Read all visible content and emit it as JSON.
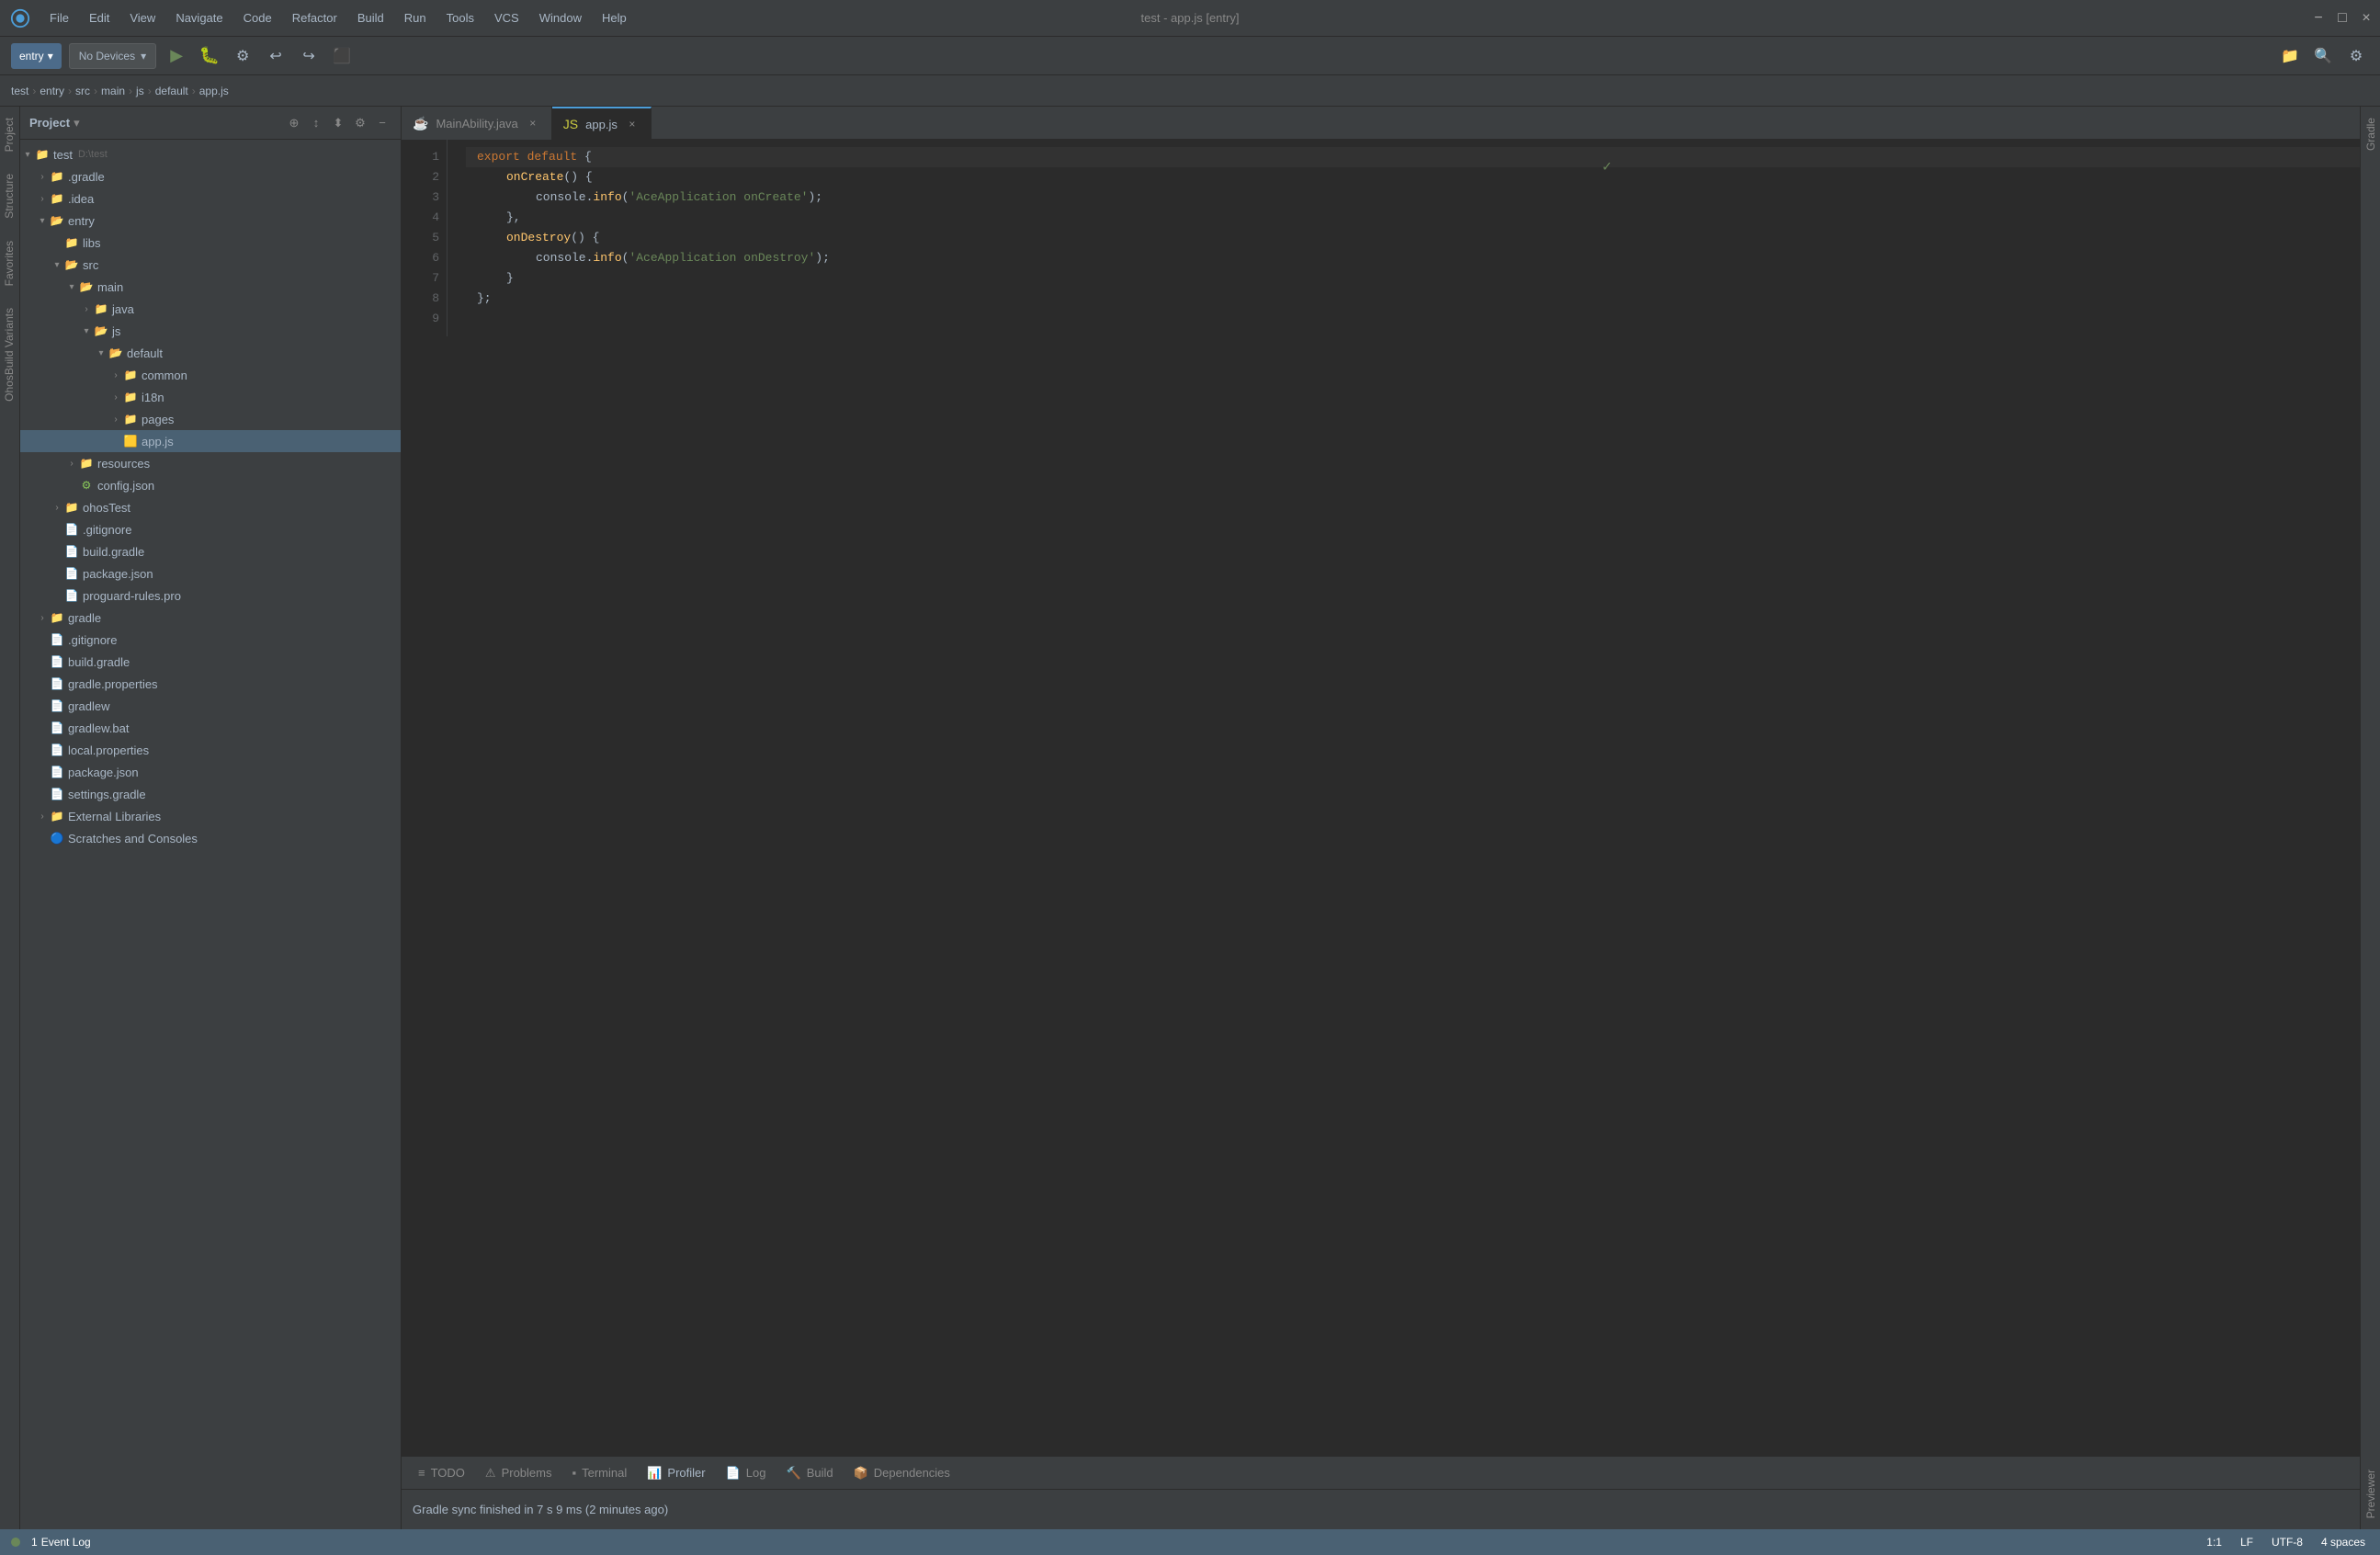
{
  "app": {
    "title": "test - app.js [entry]"
  },
  "menubar": {
    "logo_symbol": "◎",
    "items": [
      "File",
      "Edit",
      "View",
      "Navigate",
      "Code",
      "Refactor",
      "Build",
      "Run",
      "Tools",
      "VCS",
      "Window",
      "Help"
    ],
    "window_controls": [
      "−",
      "□",
      "×"
    ]
  },
  "breadcrumb": {
    "items": [
      "test",
      "entry",
      "src",
      "main",
      "js",
      "default",
      "app.js"
    ]
  },
  "toolbar": {
    "entry_label": "entry",
    "device_label": "No Devices",
    "run_symbol": "▶",
    "icons": [
      "⚙",
      "↩",
      "↪",
      "⬛",
      "📁",
      "🔍",
      "⚙"
    ]
  },
  "sidebar": {
    "title": "Project",
    "dropdown_symbol": "▾",
    "action_icons": [
      "⊕",
      "↕",
      "⬍",
      "⚙",
      "−"
    ],
    "tree": [
      {
        "id": "test",
        "label": "test",
        "suffix": "D:\\test",
        "level": 0,
        "type": "project",
        "open": true,
        "has_arrow": true
      },
      {
        "id": "gradle-dir",
        "label": ".gradle",
        "level": 1,
        "type": "folder",
        "open": false,
        "has_arrow": true
      },
      {
        "id": "idea-dir",
        "label": ".idea",
        "level": 1,
        "type": "folder",
        "open": false,
        "has_arrow": true
      },
      {
        "id": "entry-dir",
        "label": "entry",
        "level": 1,
        "type": "folder",
        "open": true,
        "has_arrow": true
      },
      {
        "id": "libs",
        "label": "libs",
        "level": 2,
        "type": "folder",
        "open": false,
        "has_arrow": false
      },
      {
        "id": "src-dir",
        "label": "src",
        "level": 2,
        "type": "folder",
        "open": true,
        "has_arrow": true
      },
      {
        "id": "main-dir",
        "label": "main",
        "level": 3,
        "type": "folder",
        "open": true,
        "has_arrow": true
      },
      {
        "id": "java-dir",
        "label": "java",
        "level": 4,
        "type": "folder",
        "open": false,
        "has_arrow": true
      },
      {
        "id": "js-dir",
        "label": "js",
        "level": 4,
        "type": "folder",
        "open": true,
        "has_arrow": true
      },
      {
        "id": "default-dir",
        "label": "default",
        "level": 5,
        "type": "folder",
        "open": true,
        "has_arrow": true
      },
      {
        "id": "common-dir",
        "label": "common",
        "level": 6,
        "type": "folder",
        "open": false,
        "has_arrow": true
      },
      {
        "id": "i18n-dir",
        "label": "i18n",
        "level": 6,
        "type": "folder",
        "open": false,
        "has_arrow": true
      },
      {
        "id": "pages-dir",
        "label": "pages",
        "level": 6,
        "type": "folder",
        "open": false,
        "has_arrow": true
      },
      {
        "id": "app-js",
        "label": "app.js",
        "level": 6,
        "type": "file-js",
        "open": false,
        "has_arrow": false,
        "selected": true
      },
      {
        "id": "resources-dir",
        "label": "resources",
        "level": 3,
        "type": "folder",
        "open": false,
        "has_arrow": true
      },
      {
        "id": "config-json",
        "label": "config.json",
        "level": 3,
        "type": "file-config",
        "open": false,
        "has_arrow": false
      },
      {
        "id": "ohostest-dir",
        "label": "ohosTest",
        "level": 2,
        "type": "folder",
        "open": false,
        "has_arrow": true
      },
      {
        "id": "gitignore",
        "label": ".gitignore",
        "level": 2,
        "type": "file-generic",
        "open": false,
        "has_arrow": false
      },
      {
        "id": "build-gradle",
        "label": "build.gradle",
        "level": 2,
        "type": "file-gradle",
        "open": false,
        "has_arrow": false
      },
      {
        "id": "package-json",
        "label": "package.json",
        "level": 2,
        "type": "file-json",
        "open": false,
        "has_arrow": false
      },
      {
        "id": "proguard",
        "label": "proguard-rules.pro",
        "level": 2,
        "type": "file-generic",
        "open": false,
        "has_arrow": false
      },
      {
        "id": "gradle-dir2",
        "label": "gradle",
        "level": 1,
        "type": "folder",
        "open": false,
        "has_arrow": true
      },
      {
        "id": "gitignore2",
        "label": ".gitignore",
        "level": 1,
        "type": "file-generic",
        "open": false,
        "has_arrow": false
      },
      {
        "id": "build-gradle2",
        "label": "build.gradle",
        "level": 1,
        "type": "file-gradle",
        "open": false,
        "has_arrow": false
      },
      {
        "id": "gradle-props",
        "label": "gradle.properties",
        "level": 1,
        "type": "file-gradle",
        "open": false,
        "has_arrow": false
      },
      {
        "id": "gradlew",
        "label": "gradlew",
        "level": 1,
        "type": "file-generic",
        "open": false,
        "has_arrow": false
      },
      {
        "id": "gradlew-bat",
        "label": "gradlew.bat",
        "level": 1,
        "type": "file-generic",
        "open": false,
        "has_arrow": false
      },
      {
        "id": "local-props",
        "label": "local.properties",
        "level": 1,
        "type": "file-generic",
        "open": false,
        "has_arrow": false
      },
      {
        "id": "package-json2",
        "label": "package.json",
        "level": 1,
        "type": "file-json",
        "open": false,
        "has_arrow": false
      },
      {
        "id": "settings-gradle",
        "label": "settings.gradle",
        "level": 1,
        "type": "file-gradle",
        "open": false,
        "has_arrow": false
      },
      {
        "id": "external-libs",
        "label": "External Libraries",
        "level": 1,
        "type": "folder",
        "open": false,
        "has_arrow": true
      },
      {
        "id": "scratches",
        "label": "Scratches and Consoles",
        "level": 1,
        "type": "folder-special",
        "open": false,
        "has_arrow": false
      }
    ]
  },
  "editor": {
    "tabs": [
      {
        "id": "tab-main",
        "label": "MainAbility.java",
        "type": "java",
        "active": false,
        "closeable": true
      },
      {
        "id": "tab-app",
        "label": "app.js",
        "type": "js",
        "active": true,
        "closeable": true
      }
    ],
    "code_lines": [
      {
        "num": 1,
        "content": "export default {",
        "highlighted": true
      },
      {
        "num": 2,
        "content": "    onCreate() {"
      },
      {
        "num": 3,
        "content": "        console.info('AceApplication onCreate');"
      },
      {
        "num": 4,
        "content": "    },"
      },
      {
        "num": 5,
        "content": "    onDestroy() {"
      },
      {
        "num": 6,
        "content": "        console.info('AceApplication onDestroy');"
      },
      {
        "num": 7,
        "content": "    }"
      },
      {
        "num": 8,
        "content": "};"
      },
      {
        "num": 9,
        "content": ""
      }
    ]
  },
  "bottom_panel": {
    "tabs": [
      {
        "id": "todo",
        "label": "TODO",
        "icon": "≡"
      },
      {
        "id": "problems",
        "label": "Problems",
        "icon": "⚠"
      },
      {
        "id": "terminal",
        "label": "Terminal",
        "icon": "▪"
      },
      {
        "id": "profiler",
        "label": "Profiler",
        "icon": "📊"
      },
      {
        "id": "log",
        "label": "Log",
        "icon": "📄"
      },
      {
        "id": "build",
        "label": "Build",
        "icon": "🔨"
      },
      {
        "id": "dependencies",
        "label": "Dependencies",
        "icon": "📦"
      }
    ],
    "message": "Gradle sync finished in 7 s 9 ms (2 minutes ago)"
  },
  "status_bar": {
    "position": "1:1",
    "line_separator": "LF",
    "encoding": "UTF-8",
    "indent": "4 spaces",
    "event_log": "Event Log",
    "event_count": "1"
  },
  "right_panel": {
    "labels": [
      "Gradle",
      "Previewer"
    ]
  },
  "left_vertical": {
    "labels": [
      "Project",
      "Structure",
      "Favorites",
      "OhosBuild Variants"
    ]
  }
}
